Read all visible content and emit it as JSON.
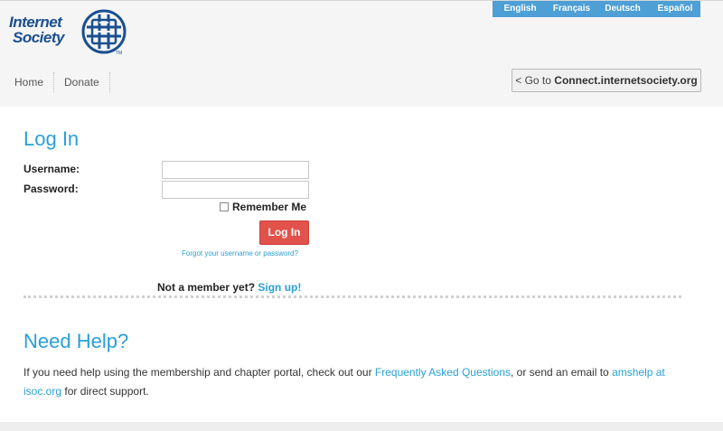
{
  "header": {
    "logo": {
      "line1": "Internet",
      "line2": "Society",
      "tm": "TM"
    },
    "languages": [
      "English",
      "Français",
      "Deutsch",
      "Español"
    ],
    "nav": [
      "Home",
      "Donate"
    ],
    "connect_button": {
      "prefix": "< Go to ",
      "site": "Connect.internetsociety.org"
    }
  },
  "login": {
    "title": "Log In",
    "username_label": "Username:",
    "password_label": "Password:",
    "username_value": "",
    "password_value": "",
    "remember_label": "Remember Me",
    "remember_checked": false,
    "submit_label": "Log In",
    "forgot_link": "Forgot your username or password?",
    "not_member_text": "Not a member yet?",
    "signup_link": "Sign up!"
  },
  "help": {
    "title": "Need Help?",
    "text_before": "If you need help using the membership and chapter portal, check out our ",
    "faq_link": "Frequently Asked Questions",
    "text_middle": ", or send an email to ",
    "email_link": "amshelp at isoc.org",
    "text_after": " for direct support."
  },
  "colors": {
    "accent": "#2a9fd8",
    "language_bar": "#4d9fd6",
    "login_button": "#e1524b",
    "logo": "#1a4f8f"
  }
}
